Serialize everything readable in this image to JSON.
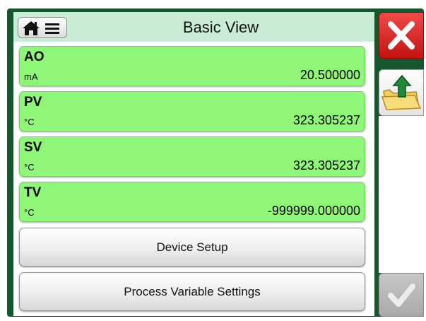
{
  "header": {
    "title": "Basic View",
    "home_icon": "home-icon",
    "menu_icon": "hamburger-menu-icon"
  },
  "variables": [
    {
      "name": "AO",
      "unit": "mA",
      "value": "20.500000"
    },
    {
      "name": "PV",
      "unit": "°C",
      "value": "323.305237"
    },
    {
      "name": "SV",
      "unit": "°C",
      "value": "323.305237"
    },
    {
      "name": "TV",
      "unit": "°C",
      "value": "-999999.000000"
    }
  ],
  "buttons": {
    "device_setup": "Device Setup",
    "process_variable_settings": "Process Variable Settings"
  },
  "side_buttons": {
    "close_icon": "close-icon",
    "upload_icon": "folder-upload-icon",
    "accept_icon": "checkmark-icon"
  },
  "colors": {
    "frame": "#17572d",
    "header": "#c9ecd6",
    "row": "#8ef777",
    "close": "#d91f1f"
  }
}
